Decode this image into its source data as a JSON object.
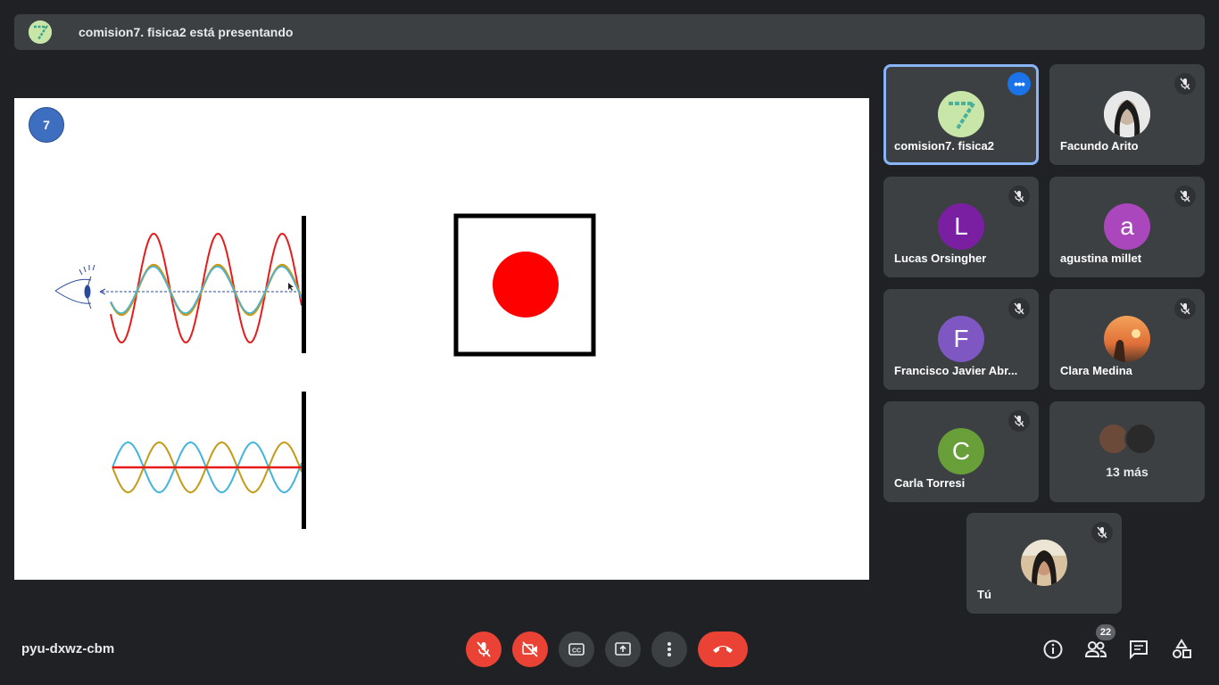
{
  "banner": {
    "text": "comision7. fisica2 está presentando"
  },
  "slide": {
    "number": "7"
  },
  "participants": [
    {
      "name": "comision7. fisica2",
      "avatar_type": "logo-7",
      "active": true
    },
    {
      "name": "Facundo Arito",
      "avatar_type": "photo",
      "muted": true
    },
    {
      "name": "Lucas Orsingher",
      "initial": "L",
      "color": "#7b1fa2",
      "muted": true
    },
    {
      "name": "agustina millet",
      "initial": "a",
      "color": "#ab47bc",
      "muted": true
    },
    {
      "name": "Francisco Javier Abr...",
      "initial": "F",
      "color": "#7e57c2",
      "muted": true
    },
    {
      "name": "Clara Medina",
      "avatar_type": "photo",
      "muted": true
    },
    {
      "name": "Carla Torresi",
      "initial": "C",
      "color": "#689f38",
      "muted": true
    },
    {
      "more_label": "13 más"
    },
    {
      "name": "Tú",
      "avatar_type": "photo",
      "muted": true
    }
  ],
  "footer": {
    "meeting_code": "pyu-dxwz-cbm",
    "people_count": "22"
  },
  "colors": {
    "red": "#ea4335",
    "tile": "#3c4043",
    "bg": "#202124",
    "accent": "#8ab4f8"
  }
}
